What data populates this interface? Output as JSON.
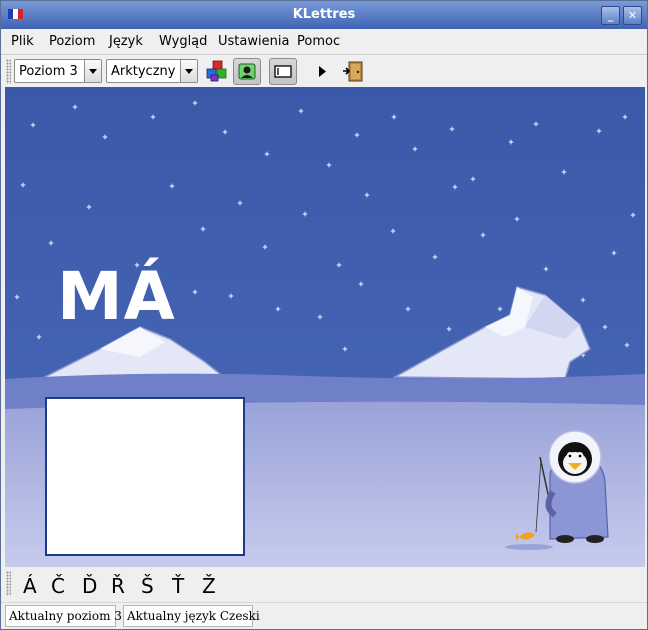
{
  "window": {
    "title": "KLettres"
  },
  "menu": [
    "Plik",
    "Poziom",
    "Język",
    "Wygląd",
    "Ustawienia",
    "Pomoc"
  ],
  "toolbar": {
    "level_combo": "Poziom 3",
    "theme_combo": "Arktyczny",
    "tools": [
      "blocks-icon",
      "grownup-icon",
      "menubar-icon",
      "play-icon",
      "quit-door-icon"
    ]
  },
  "scene": {
    "word": "MÁ",
    "answer": ""
  },
  "special_letters": [
    "Á",
    "Č",
    "Ď",
    "Ř",
    "Š",
    "Ť",
    "Ž"
  ],
  "status": {
    "level": "Aktualny poziom 3",
    "language": "Aktualny język Czeski"
  },
  "colors": {
    "sky": "#3a59a8",
    "ice": "#b9bfe8",
    "titlebar": "#5276c4"
  }
}
